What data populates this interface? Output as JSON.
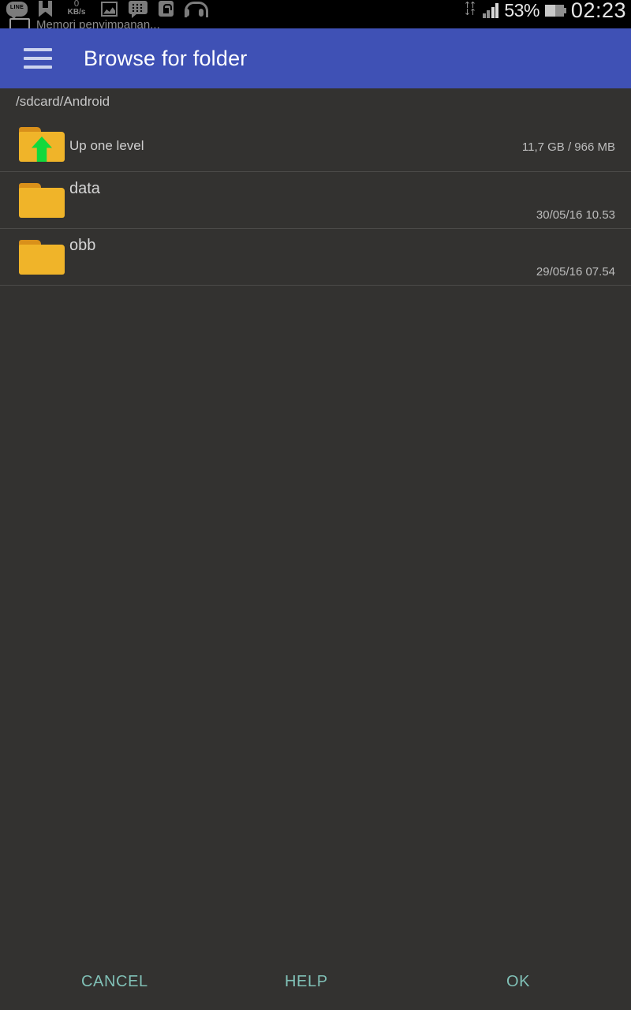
{
  "status_bar": {
    "left_icons": [
      {
        "name": "line-icon",
        "label": "LINE"
      },
      {
        "name": "bookmark-icon",
        "label": ""
      },
      {
        "name": "network-speed-icon",
        "value": "0",
        "unit": "KB/s"
      },
      {
        "name": "gallery-icon",
        "label": ""
      },
      {
        "name": "bbm-icon",
        "label": ""
      },
      {
        "name": "lock-icon",
        "label": ""
      },
      {
        "name": "headphones-icon",
        "label": ""
      }
    ],
    "notification_preview": "Memori penyimpanan...",
    "data_transfer_icon": "data-transfer-icon",
    "signal_icon": "signal-bars-icon",
    "battery_percent": "53%",
    "battery_level": 53,
    "clock": "02:23"
  },
  "appbar": {
    "menu_icon": "hamburger-menu-icon",
    "title": "Browse for folder",
    "background_color": "#3f51b5"
  },
  "path": {
    "current": "/sdcard/Android"
  },
  "file_list": [
    {
      "icon": "folder-up-icon",
      "name": "Up one level",
      "meta": "11,7 GB / 966 MB",
      "type": "up"
    },
    {
      "icon": "folder-icon",
      "name": "data",
      "meta": "30/05/16 10.53",
      "type": "folder"
    },
    {
      "icon": "folder-icon",
      "name": "obb",
      "meta": "29/05/16 07.54",
      "type": "folder"
    }
  ],
  "footer": {
    "cancel_label": "CANCEL",
    "help_label": "HELP",
    "ok_label": "OK",
    "accent_color": "#80c0b6"
  },
  "theme": {
    "background": "#333230",
    "divider": "#4b4a48",
    "folder_yellow": "#f0b429",
    "arrow_green": "#12d93c"
  }
}
